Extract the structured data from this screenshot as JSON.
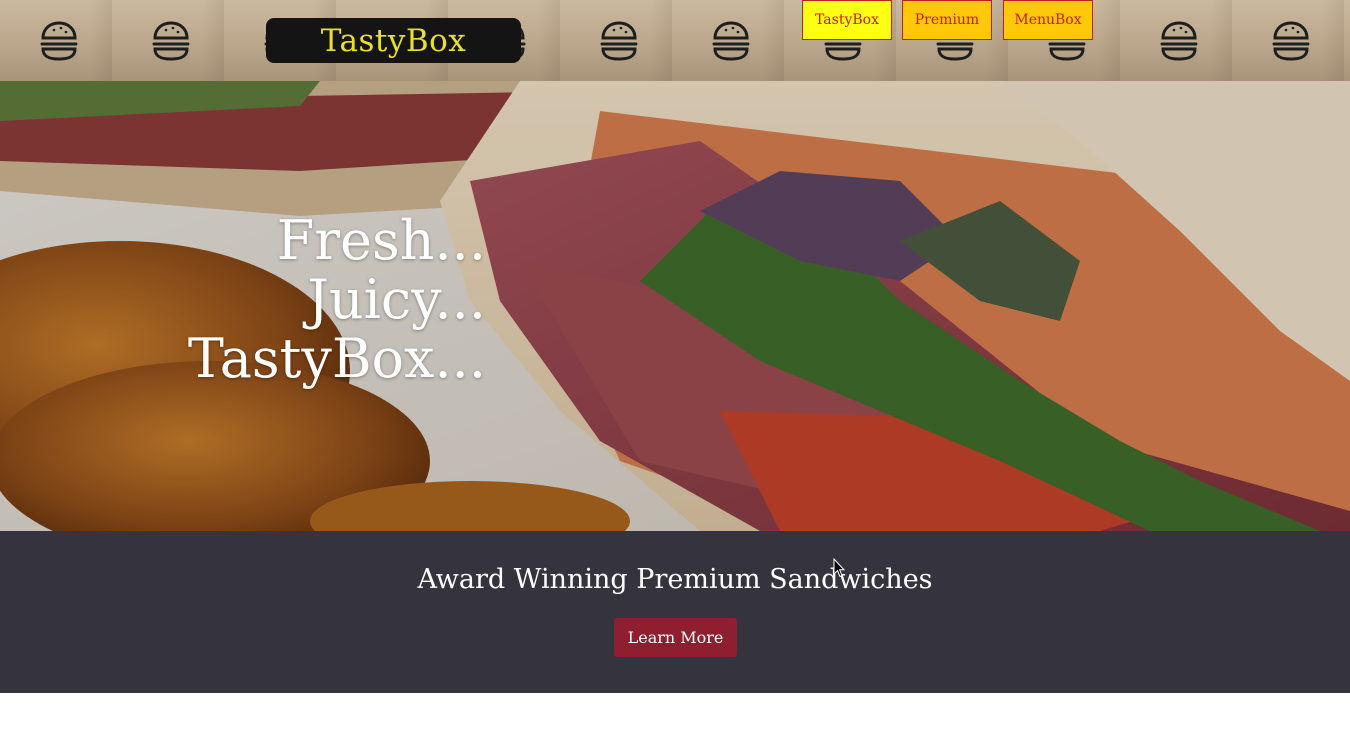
{
  "header": {
    "logo_text": "TastyBox",
    "nav": [
      {
        "label": "TastyBox"
      },
      {
        "label": "Premium"
      },
      {
        "label": "MenuBox"
      }
    ],
    "background_icon": "burger-icon",
    "colors": {
      "logo_bg": "#141414",
      "logo_text": "#e8e02a",
      "nav_active_bg": "#ffff14",
      "nav_bg": "#ffc80a",
      "nav_text": "#c21e1e"
    }
  },
  "hero": {
    "image": "sandwich-photo",
    "tagline": [
      "Fresh...",
      "Juicy...",
      "TastyBox..."
    ]
  },
  "promo": {
    "title": "Award Winning Premium Sandwiches",
    "button_label": "Learn More",
    "colors": {
      "band_bg": "#35333d",
      "button_bg": "#8f1f30"
    }
  }
}
